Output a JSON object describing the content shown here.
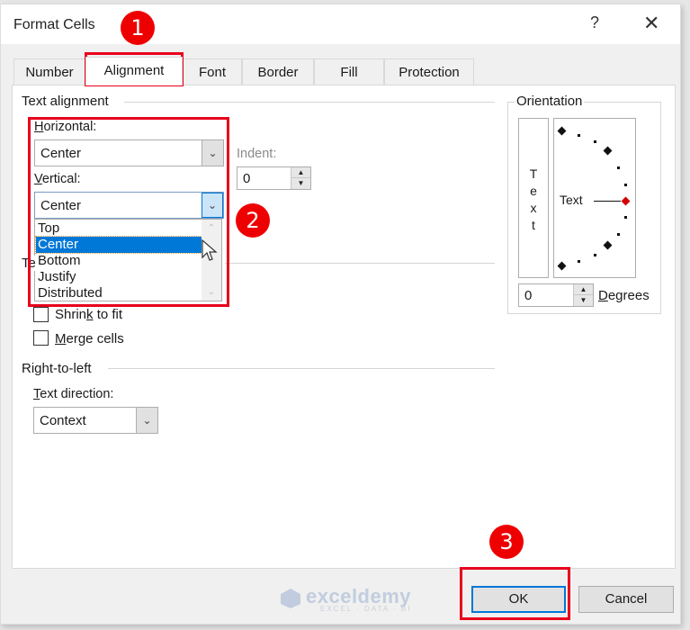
{
  "window": {
    "title": "Format Cells",
    "help_label": "?",
    "close_label": "✕"
  },
  "tabs": [
    {
      "label": "Number",
      "active": false
    },
    {
      "label": "Alignment",
      "active": true
    },
    {
      "label": "Font",
      "active": false
    },
    {
      "label": "Border",
      "active": false
    },
    {
      "label": "Fill",
      "active": false
    },
    {
      "label": "Protection",
      "active": false
    }
  ],
  "text_alignment": {
    "group_label": "Text alignment",
    "horizontal": {
      "label_u": "H",
      "label_rest": "orizontal:",
      "value": "Center"
    },
    "vertical": {
      "label_u": "V",
      "label_rest": "ertical:",
      "value": "Center",
      "options": [
        "Top",
        "Center",
        "Bottom",
        "Justify",
        "Distributed"
      ],
      "selected": "Center",
      "expanded": true
    },
    "indent": {
      "label": "Indent:",
      "value": "0",
      "disabled": true
    }
  },
  "text_control": {
    "group_label_partial": "Te",
    "shrink_to_fit": {
      "label_pre": "Shrin",
      "label_u": "k",
      "label_post": " to fit",
      "checked": false
    },
    "merge_cells": {
      "label_u": "M",
      "label_post": "erge cells",
      "checked": false
    }
  },
  "right_to_left": {
    "group_label": "Right-to-left",
    "text_direction": {
      "label_u": "T",
      "label_rest": "ext direction:",
      "value": "Context"
    }
  },
  "orientation": {
    "group_label": "Orientation",
    "vertical_text": [
      "T",
      "e",
      "x",
      "t"
    ],
    "dial_text": "Text",
    "degrees_value": "0",
    "degrees_label_u": "D",
    "degrees_label_rest": "egrees"
  },
  "buttons": {
    "ok": "OK",
    "cancel": "Cancel"
  },
  "annotations": {
    "step1": "1",
    "step2": "2",
    "step3": "3",
    "highlight_color": "#e8001c"
  },
  "watermark": {
    "name": "exceldemy",
    "tagline": "EXCEL · DATA · BI"
  }
}
